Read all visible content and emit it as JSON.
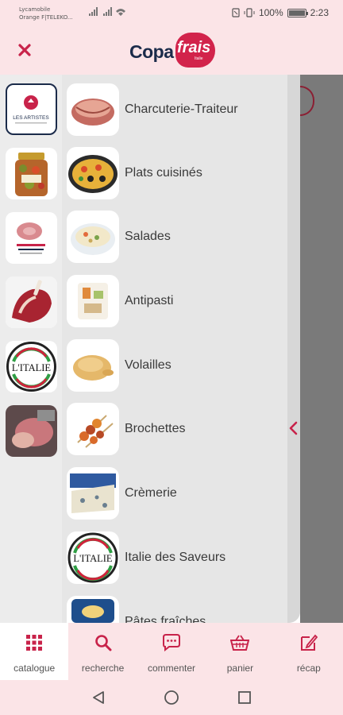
{
  "status_bar": {
    "carrier_line1": "Lycamobile",
    "carrier_line2": "Orange F|TELEKO...",
    "battery": "100%",
    "time": "2:23"
  },
  "header": {
    "logo_text": "Copa",
    "logo_frais": "frais",
    "logo_sub": "Italie",
    "close_icon": "close-icon"
  },
  "brands": [
    {
      "name": "les-artistes",
      "label": "LES ARTISTES",
      "icon": "circle-logo"
    },
    {
      "name": "antipasti-jar",
      "label": "",
      "icon": "jar-photo"
    },
    {
      "name": "rondelli",
      "label": "",
      "icon": "ham-photo"
    },
    {
      "name": "meat-cuts",
      "label": "",
      "icon": "meat-photo"
    },
    {
      "name": "l-italie",
      "label": "L'ITALIE",
      "icon": "italie-logo"
    },
    {
      "name": "ham-slicing",
      "label": "",
      "icon": "slicing-photo"
    }
  ],
  "categories": [
    {
      "label": "Charcuterie-Traiteur"
    },
    {
      "label": "Plats cuisinés"
    },
    {
      "label": "Salades"
    },
    {
      "label": "Antipasti"
    },
    {
      "label": "Volailles"
    },
    {
      "label": "Brochettes"
    },
    {
      "label": "Crèmerie"
    },
    {
      "label": "Italie des Saveurs"
    },
    {
      "label": "Pâtes fraîches"
    }
  ],
  "bottom_nav": [
    {
      "label": "catalogue",
      "icon": "grid-icon",
      "active": true
    },
    {
      "label": "recherche",
      "icon": "search-icon",
      "active": false
    },
    {
      "label": "commenter",
      "icon": "comment-icon",
      "active": false
    },
    {
      "label": "panier",
      "icon": "basket-icon",
      "active": false
    },
    {
      "label": "récap",
      "icon": "edit-icon",
      "active": false
    }
  ],
  "italie_text": "L'ITALIE",
  "colors": {
    "accent": "#d2234b",
    "nav_bg": "#fbe4e7",
    "navy": "#1b2b4a"
  }
}
